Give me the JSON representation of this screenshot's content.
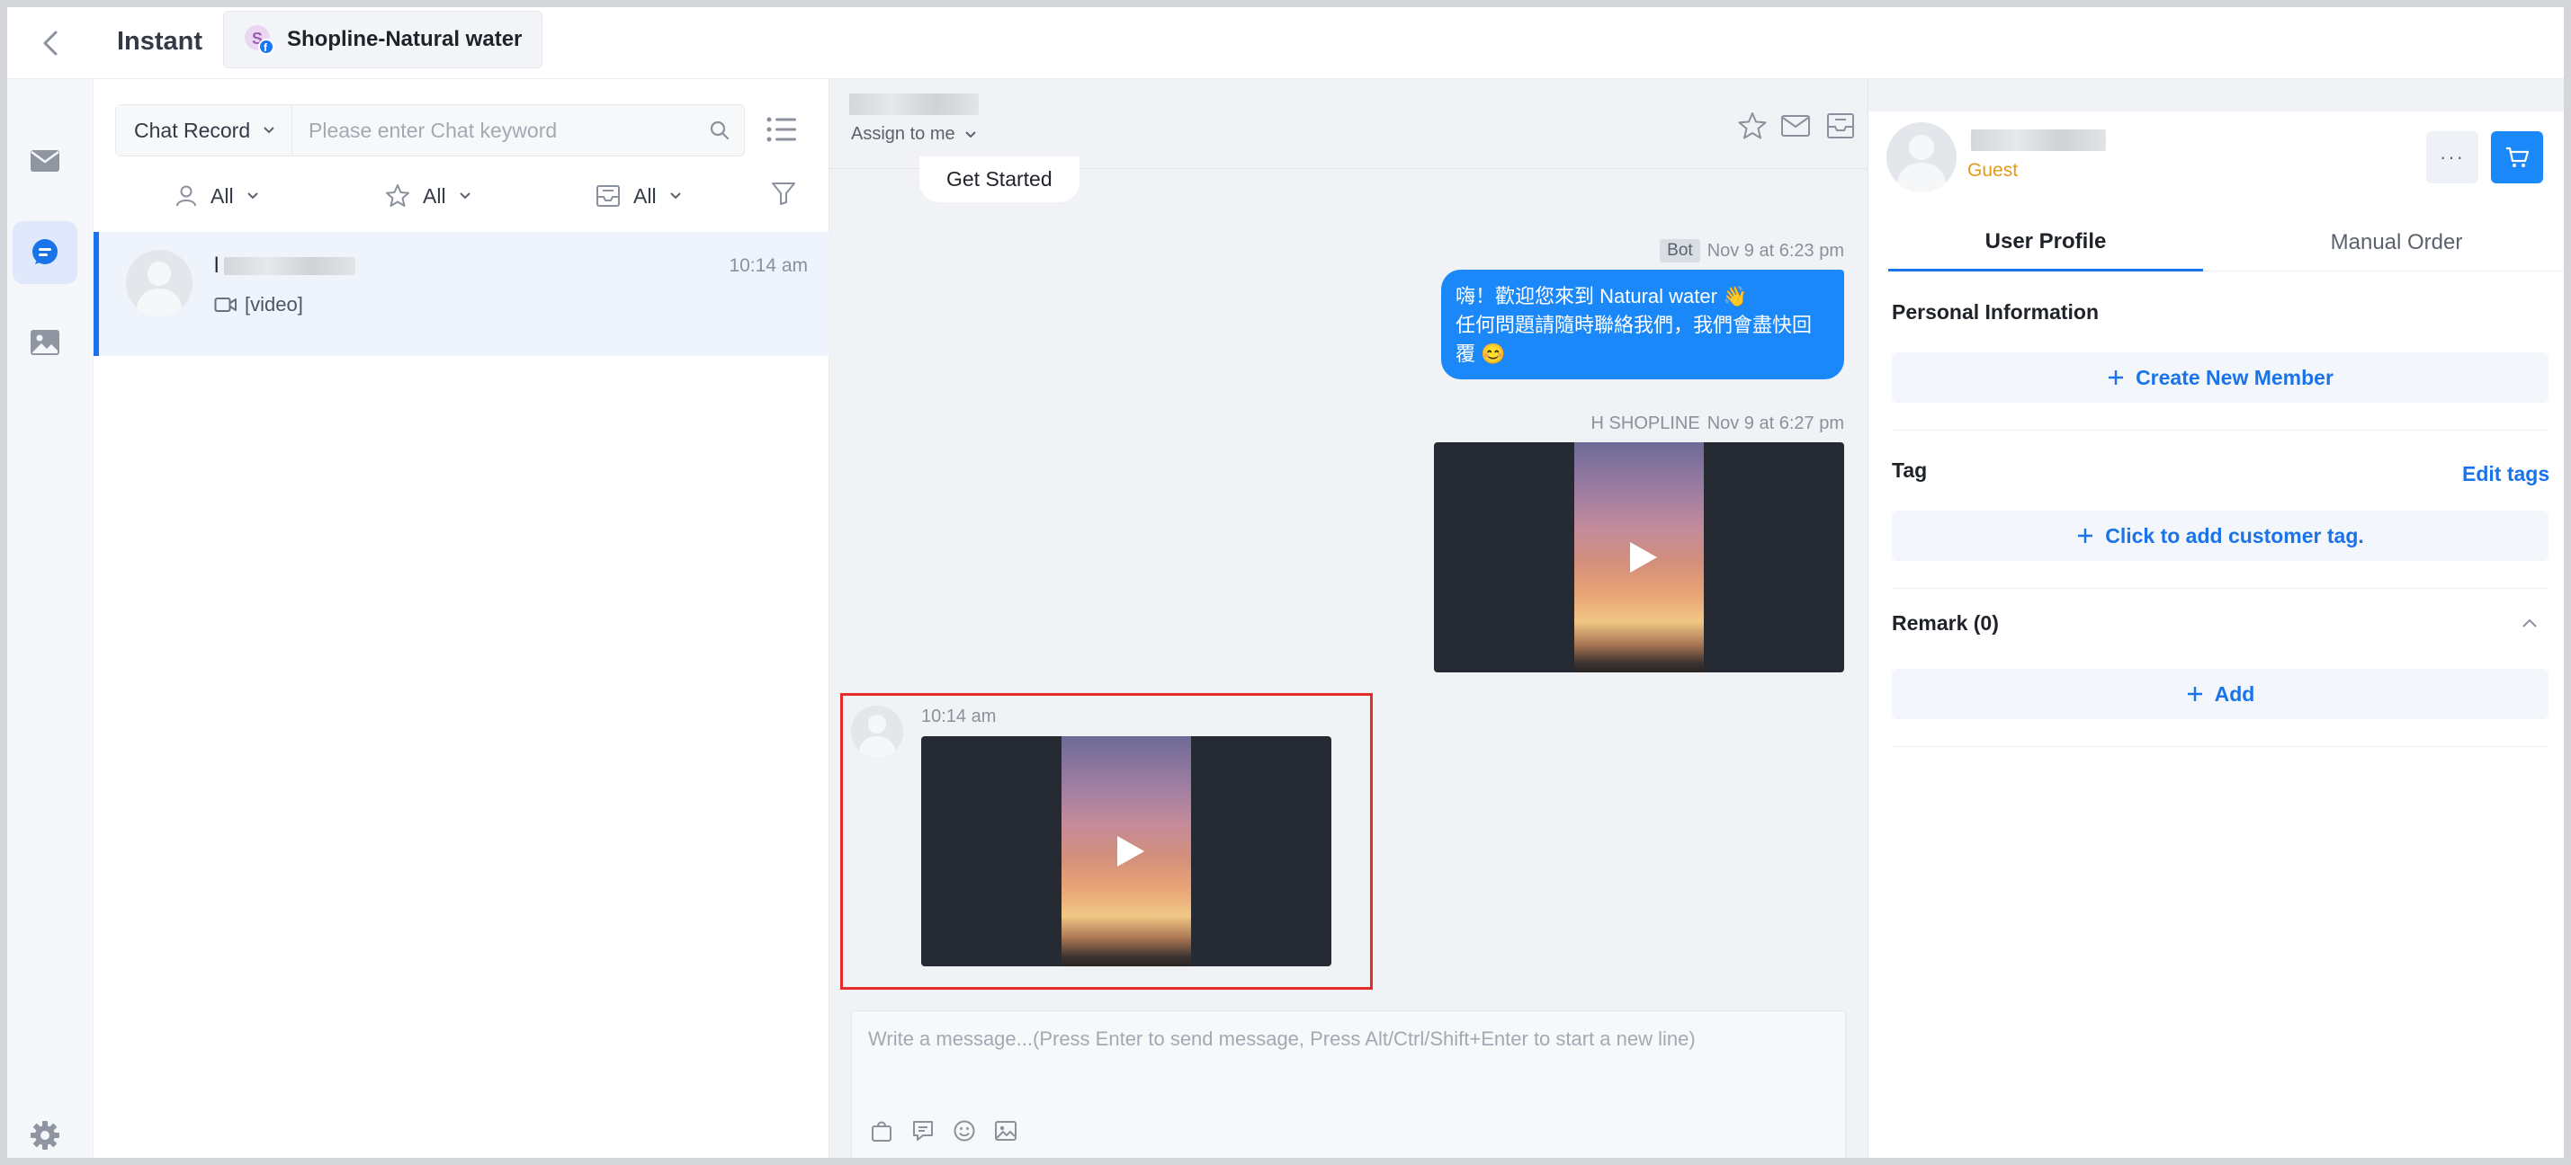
{
  "app": {
    "title": "Instant"
  },
  "store_tab": {
    "label": "Shopline-Natural water"
  },
  "conversation_list": {
    "search": {
      "select_label": "Chat Record",
      "placeholder": "Please enter Chat keyword"
    },
    "filters": [
      {
        "label": "All",
        "icon": "person-icon"
      },
      {
        "label": "All",
        "icon": "star-icon"
      },
      {
        "label": "All",
        "icon": "inbox-icon"
      }
    ],
    "items": [
      {
        "name_initial": "l",
        "time": "10:14 am",
        "preview": "[video]"
      }
    ]
  },
  "chat": {
    "assign_label": "Assign to me",
    "get_started": "Get Started",
    "messages": {
      "bot": {
        "sender": "Bot",
        "time": "Nov 9 at 6:23 pm",
        "line1": "嗨！歡迎您來到 Natural water 👋",
        "line2": "任何問題請隨時聯絡我們，我們會盡快回",
        "line3": "覆 😊"
      },
      "agent_video": {
        "sender": "H SHOPLINE",
        "time": "Nov 9 at 6:27 pm"
      },
      "customer_video": {
        "time": "10:14 am"
      }
    },
    "composer": {
      "placeholder": "Write a message...(Press Enter to send message, Press Alt/Ctrl/Shift+Enter to start a new line)"
    }
  },
  "profile": {
    "role": "Guest",
    "more_label": "···",
    "tabs": [
      "User Profile",
      "Manual Order"
    ],
    "personal_info": {
      "title": "Personal Information",
      "create_member": "Create New Member"
    },
    "tag": {
      "title": "Tag",
      "edit": "Edit tags",
      "add": "Click to add customer tag."
    },
    "remark": {
      "title": "Remark (0)",
      "add": "Add"
    }
  },
  "colors": {
    "accent": "#1a73e8",
    "bubble": "#1a88f8",
    "guest": "#e29a1b",
    "highlight": "#e42b2b"
  }
}
